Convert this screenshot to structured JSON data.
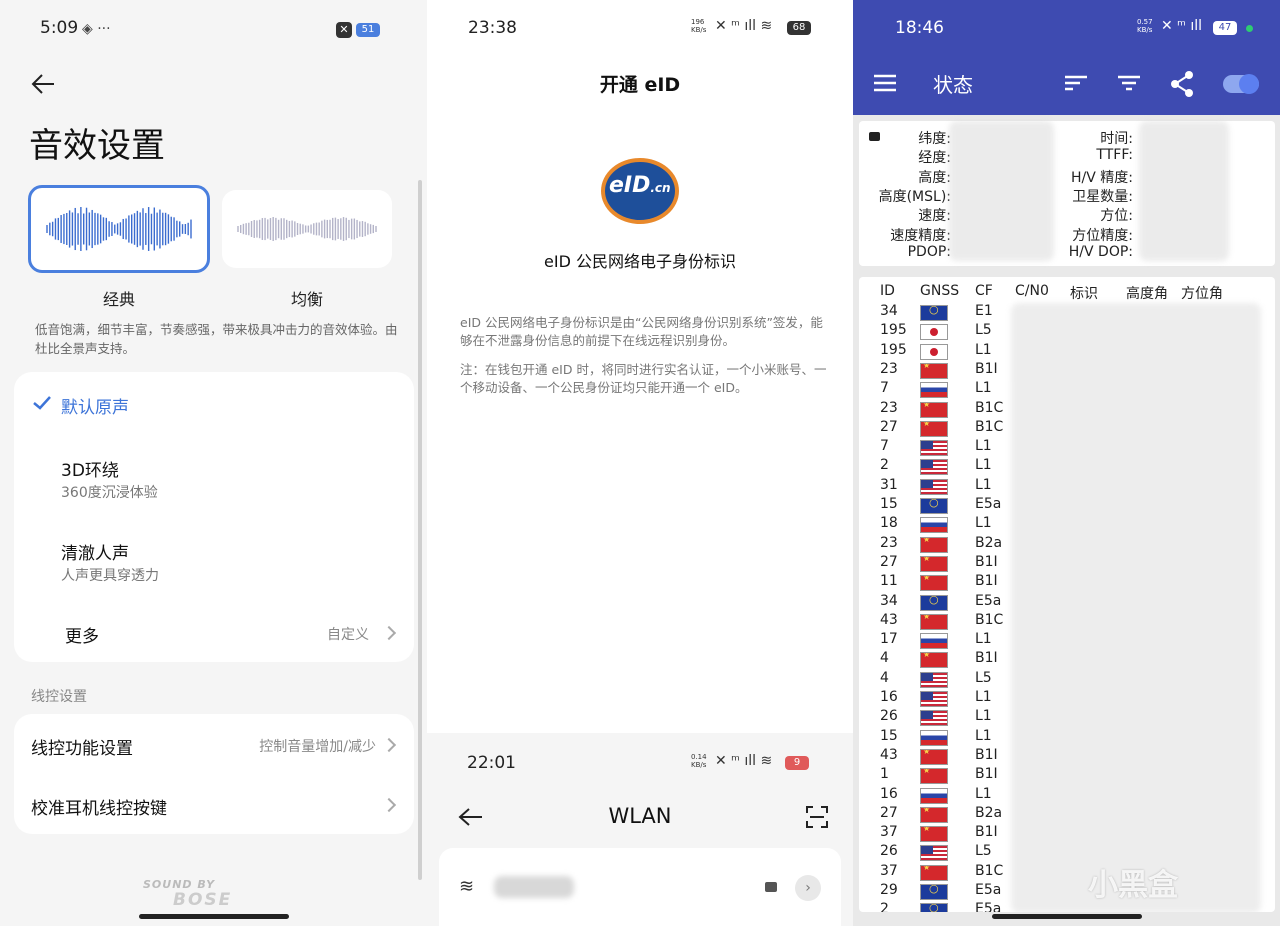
{
  "panel1": {
    "status_time": "5:09",
    "status_extra": "◈ ···",
    "battery": "51",
    "title": "音效设置",
    "modes": [
      {
        "label": "经典",
        "selected": true
      },
      {
        "label": "均衡",
        "selected": false
      }
    ],
    "mode_desc": "低音饱满，细节丰富，节奏感强，带来极具冲击力的音效体验。由杜比全景声支持。",
    "options": [
      {
        "title": "默认原声",
        "sub": "",
        "checked": true
      },
      {
        "title": "3D环绕",
        "sub": "360度沉浸体验",
        "checked": false
      },
      {
        "title": "清澈人声",
        "sub": "人声更具穿透力",
        "checked": false
      }
    ],
    "more": {
      "title": "更多",
      "value": "自定义"
    },
    "section_wire": "线控设置",
    "wire_items": [
      {
        "title": "线控功能设置",
        "value": "控制音量增加/减少"
      },
      {
        "title": "校准耳机线控按键",
        "value": ""
      }
    ],
    "brand_small": "SOUND BY",
    "brand_big": "BOSE"
  },
  "panel2": {
    "status_time": "23:38",
    "net_speed": "196 KB/s",
    "battery": "68",
    "header": "开通 eID",
    "logo_text": "eID",
    "logo_suffix": ".cn",
    "subtitle": "eID 公民网络电子身份标识",
    "para1": "eID 公民网络电子身份标识是由“公民网络身份识别系统”签发，能够在不泄露身份信息的前提下在线远程识别身份。",
    "para2": "注：在钱包开通 eID 时，将同时进行实名认证，一个小米账号、一个移动设备、一个公民身份证均只能开通一个 eID。",
    "bottom_status_time": "22:01",
    "bottom_net_speed": "0.14 KB/s",
    "bottom_battery": "9",
    "wlan_title": "WLAN"
  },
  "panel3": {
    "status_time": "18:46",
    "net_speed": "0.57 KB/s",
    "battery": "47",
    "app_title": "状态",
    "info_left": [
      "纬度:",
      "经度:",
      "高度:",
      "高度(MSL):",
      "速度:",
      "速度精度:",
      "PDOP:"
    ],
    "info_right": [
      "时间:",
      "TTFF:",
      "H/V 精度:",
      "卫星数量:",
      "方位:",
      "方位精度:",
      "H/V DOP:"
    ],
    "table_headers": [
      "ID",
      "GNSS",
      "CF",
      "C/N0",
      "标识",
      "高度角",
      "方位角"
    ],
    "rows": [
      {
        "id": "34",
        "gnss": "eu",
        "cf": "E1"
      },
      {
        "id": "195",
        "gnss": "jp",
        "cf": "L5"
      },
      {
        "id": "195",
        "gnss": "jp",
        "cf": "L1"
      },
      {
        "id": "23",
        "gnss": "cn",
        "cf": "B1I"
      },
      {
        "id": "7",
        "gnss": "ru",
        "cf": "L1"
      },
      {
        "id": "23",
        "gnss": "cn",
        "cf": "B1C"
      },
      {
        "id": "27",
        "gnss": "cn",
        "cf": "B1C"
      },
      {
        "id": "7",
        "gnss": "us",
        "cf": "L1"
      },
      {
        "id": "2",
        "gnss": "us",
        "cf": "L1"
      },
      {
        "id": "31",
        "gnss": "us",
        "cf": "L1"
      },
      {
        "id": "15",
        "gnss": "eu",
        "cf": "E5a"
      },
      {
        "id": "18",
        "gnss": "ru",
        "cf": "L1"
      },
      {
        "id": "23",
        "gnss": "cn",
        "cf": "B2a"
      },
      {
        "id": "27",
        "gnss": "cn",
        "cf": "B1I"
      },
      {
        "id": "11",
        "gnss": "cn",
        "cf": "B1I"
      },
      {
        "id": "34",
        "gnss": "eu",
        "cf": "E5a"
      },
      {
        "id": "43",
        "gnss": "cn",
        "cf": "B1C"
      },
      {
        "id": "17",
        "gnss": "ru",
        "cf": "L1"
      },
      {
        "id": "4",
        "gnss": "cn",
        "cf": "B1I"
      },
      {
        "id": "4",
        "gnss": "us",
        "cf": "L5"
      },
      {
        "id": "16",
        "gnss": "us",
        "cf": "L1"
      },
      {
        "id": "26",
        "gnss": "us",
        "cf": "L1"
      },
      {
        "id": "15",
        "gnss": "ru",
        "cf": "L1"
      },
      {
        "id": "43",
        "gnss": "cn",
        "cf": "B1I"
      },
      {
        "id": "1",
        "gnss": "cn",
        "cf": "B1I"
      },
      {
        "id": "16",
        "gnss": "ru",
        "cf": "L1"
      },
      {
        "id": "27",
        "gnss": "cn",
        "cf": "B2a"
      },
      {
        "id": "37",
        "gnss": "cn",
        "cf": "B1I"
      },
      {
        "id": "26",
        "gnss": "us",
        "cf": "L5"
      },
      {
        "id": "37",
        "gnss": "cn",
        "cf": "B1C"
      },
      {
        "id": "29",
        "gnss": "eu",
        "cf": "E5a"
      },
      {
        "id": "2",
        "gnss": "eu",
        "cf": "E5a"
      }
    ],
    "watermark": "小黑盒"
  },
  "colors": {
    "accent_blue": "#4a7fde",
    "app_bar": "#3e4bb1"
  }
}
